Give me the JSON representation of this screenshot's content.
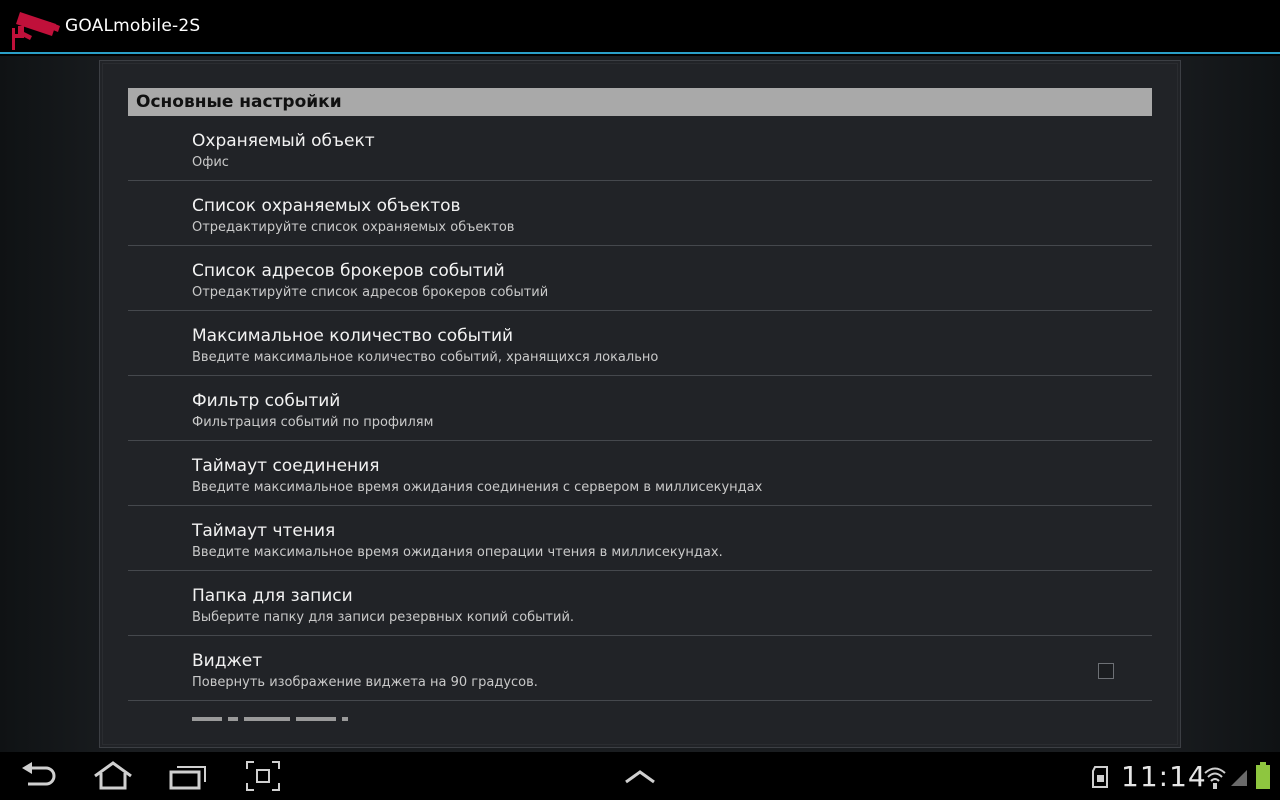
{
  "app": {
    "title": "GOALmobile-2S",
    "icon": "security-camera-icon",
    "accent_color": "#2a9fc7",
    "icon_color": "#c0103a"
  },
  "settings": {
    "category_title": "Основные настройки",
    "items": [
      {
        "title": "Охраняемый объект",
        "summary": "Офис"
      },
      {
        "title": "Список охраняемых объектов",
        "summary": "Отредактируйте список охраняемых объектов"
      },
      {
        "title": "Список адресов брокеров событий",
        "summary": "Отредактируйте список адресов брокеров событий"
      },
      {
        "title": "Максимальное количество событий",
        "summary": "Введите максимальное количество событий, хранящихся локально"
      },
      {
        "title": "Фильтр событий",
        "summary": "Фильтрация событий по профилям"
      },
      {
        "title": "Таймаут соединения",
        "summary": "Введите максимальное время ожидания соединения с сервером в миллисекундах"
      },
      {
        "title": "Таймаут чтения",
        "summary": "Введите максимальное время ожидания операции чтения в миллисекундах."
      },
      {
        "title": "Папка для записи",
        "summary": "Выберите папку для записи резервных копий событий."
      },
      {
        "title": "Виджет",
        "summary": "Повернуть изображение виджета на 90 градусов.",
        "checkbox_checked": false
      }
    ]
  },
  "navbar": {
    "buttons": [
      "back-icon",
      "home-icon",
      "recent-apps-icon",
      "screenshot-icon",
      "chevron-up-icon"
    ],
    "status": {
      "clock": "11:14",
      "icons": [
        "sd-card-icon",
        "wifi-icon",
        "signal-icon",
        "battery-icon"
      ],
      "battery_color": "#8ec63f"
    }
  }
}
